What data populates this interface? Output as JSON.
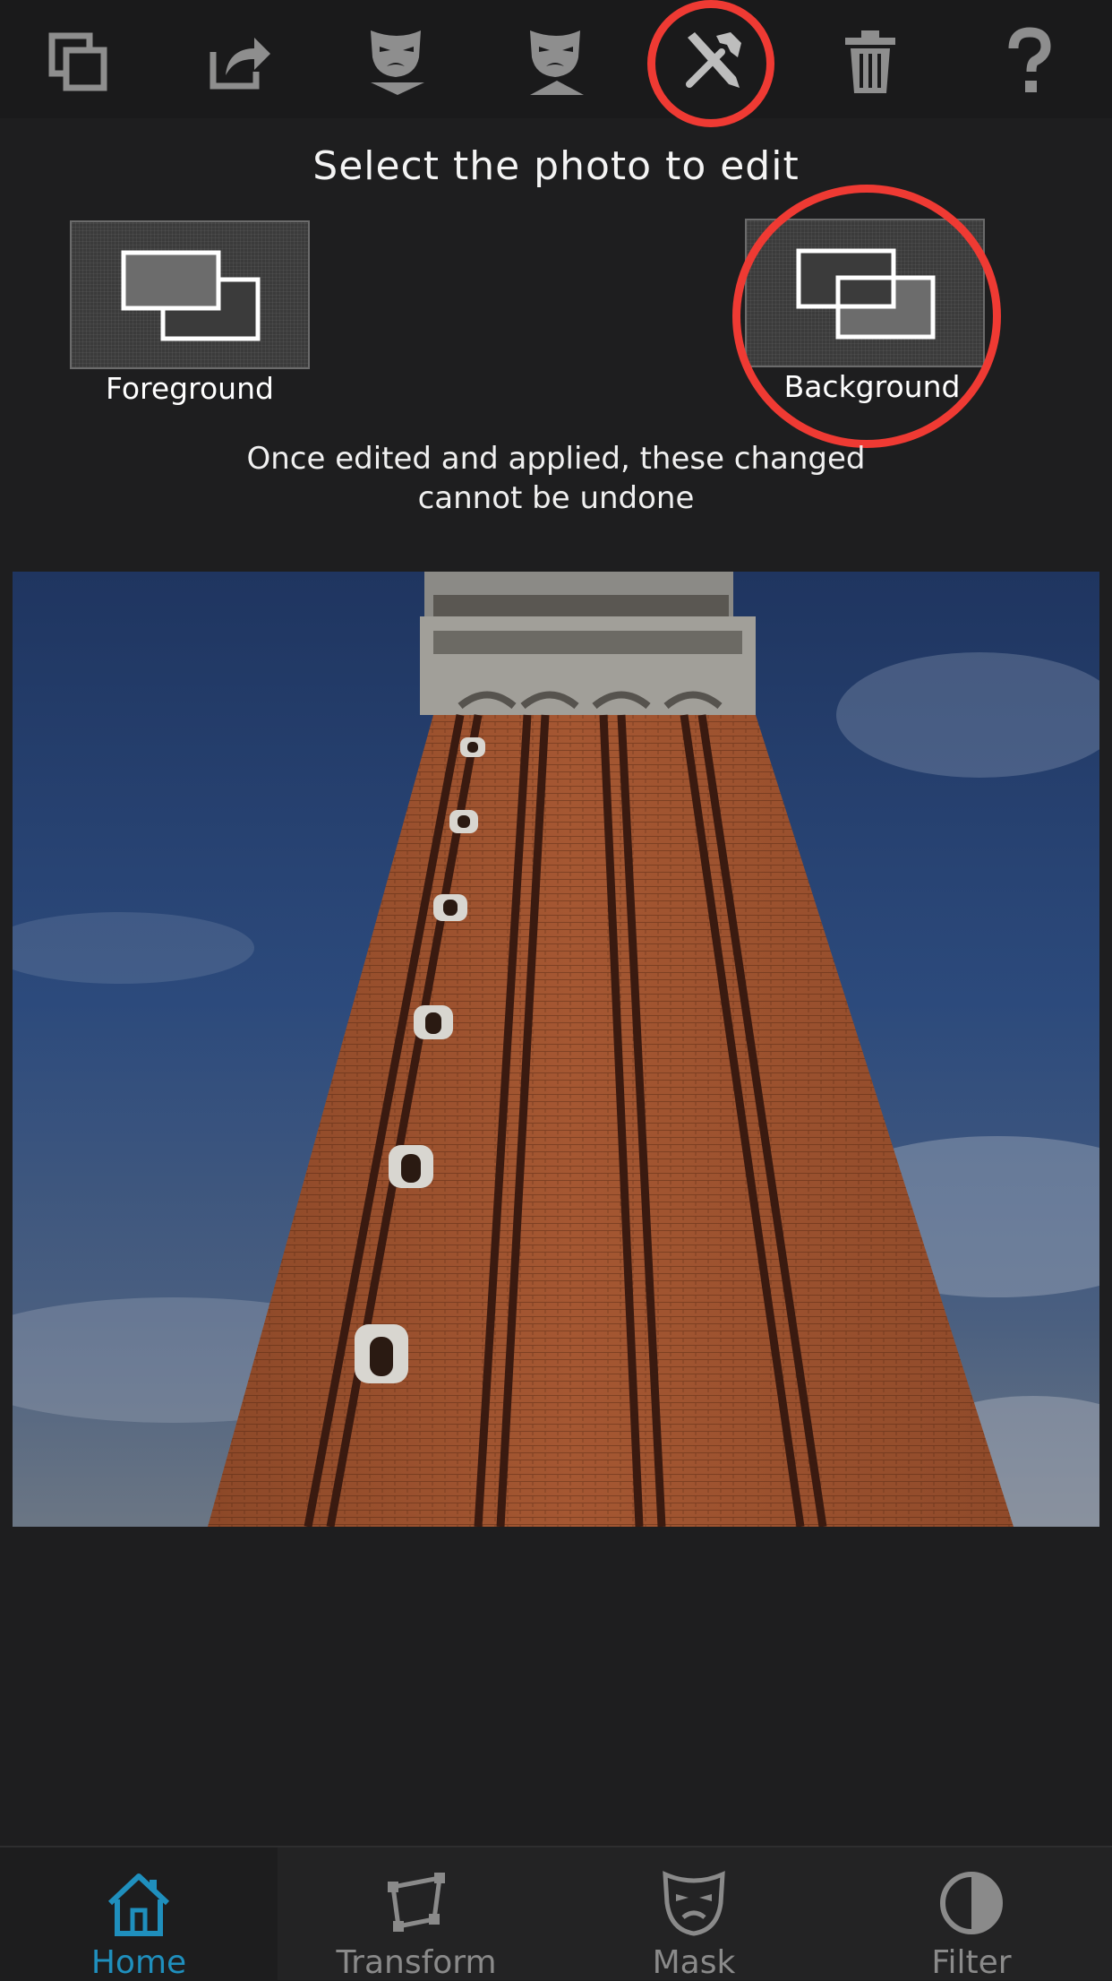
{
  "toolbar": {
    "buttons": [
      {
        "name": "layers-icon"
      },
      {
        "name": "share-icon"
      },
      {
        "name": "mask-down-icon"
      },
      {
        "name": "mask-up-icon"
      },
      {
        "name": "tools-icon",
        "highlighted": true
      },
      {
        "name": "trash-icon"
      },
      {
        "name": "help-icon"
      }
    ]
  },
  "prompt": {
    "title": "Select the photo to edit",
    "warning_line1": "Once edited and applied, these changed",
    "warning_line2": "cannot be undone"
  },
  "options": {
    "foreground_label": "Foreground",
    "background_label": "Background",
    "highlighted": "Background"
  },
  "tabs": [
    {
      "label": "Home",
      "icon": "home-icon",
      "active": true
    },
    {
      "label": "Transform",
      "icon": "transform-icon",
      "active": false
    },
    {
      "label": "Mask",
      "icon": "mask-icon",
      "active": false
    },
    {
      "label": "Filter",
      "icon": "filter-icon",
      "active": false
    }
  ],
  "colors": {
    "accent": "#1f8fbd",
    "highlight_ring": "#ef3a33",
    "background": "#1e1e1f"
  }
}
